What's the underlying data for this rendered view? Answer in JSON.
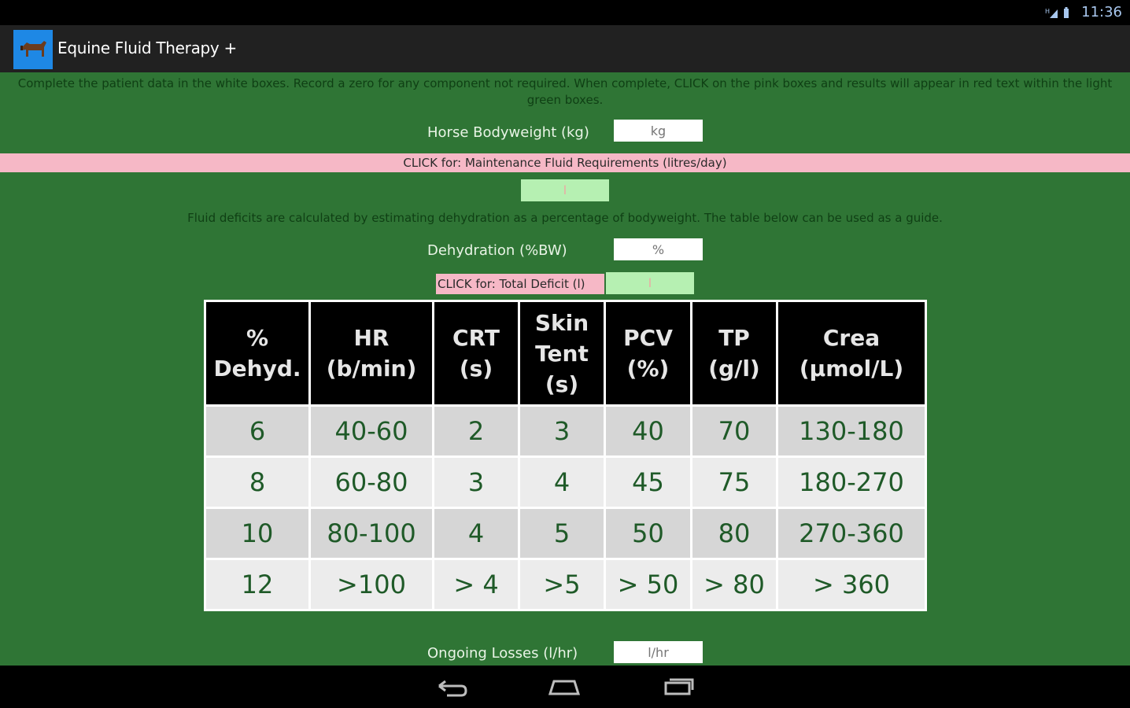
{
  "status_bar": {
    "signal_text": "H",
    "time": "11:36"
  },
  "action_bar": {
    "app_title": "Equine Fluid Therapy +"
  },
  "instructions": "Complete the patient data in the white boxes. Record a zero for any component not required. When complete, CLICK on the pink boxes and results will appear in red text within the light green boxes.",
  "bodyweight": {
    "label": "Horse Bodyweight (kg)",
    "placeholder": "kg"
  },
  "maintenance": {
    "button_label": "CLICK for: Maintenance Fluid Requirements (litres/day)",
    "result": "l"
  },
  "deficit_note": "Fluid deficits are calculated by estimating dehydration as a percentage of bodyweight. The table below can be used as a guide.",
  "dehydration": {
    "label": "Dehydration (%BW)",
    "placeholder": "%"
  },
  "total_deficit": {
    "button_label": "CLICK for: Total Deficit (l)",
    "result": "l"
  },
  "guide_table": {
    "headers": [
      [
        "%",
        "Dehyd."
      ],
      [
        "HR",
        "(b/min)"
      ],
      [
        "CRT",
        "(s)"
      ],
      [
        "Skin",
        "Tent",
        "(s)"
      ],
      [
        "PCV",
        "(%)"
      ],
      [
        "TP",
        "(g/l)"
      ],
      [
        "Crea",
        "(µmol/L)"
      ]
    ],
    "rows": [
      [
        "6",
        "40-60",
        "2",
        "3",
        "40",
        "70",
        "130-180"
      ],
      [
        "8",
        "60-80",
        "3",
        "4",
        "45",
        "75",
        "180-270"
      ],
      [
        "10",
        "80-100",
        "4",
        "5",
        "50",
        "80",
        "270-360"
      ],
      [
        "12",
        ">100",
        "> 4",
        ">5",
        "> 50",
        "> 80",
        "> 360"
      ]
    ]
  },
  "ongoing_losses": {
    "label": "Ongoing Losses (l/hr)",
    "placeholder": "l/hr"
  },
  "colors": {
    "background": "#2f7535",
    "pink": "#f6b8c6",
    "light_green": "#b6f0b2",
    "table_header": "#000000",
    "table_text": "#1f5a28"
  },
  "nav_icons": [
    "back-icon",
    "home-icon",
    "recent-apps-icon"
  ]
}
